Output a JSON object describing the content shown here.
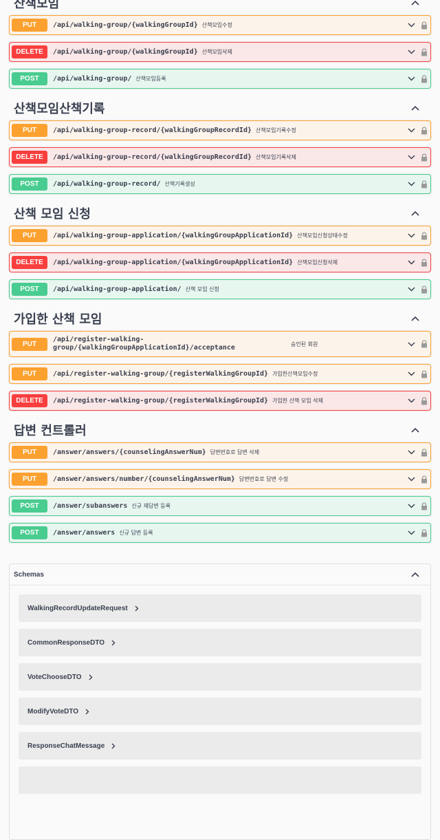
{
  "sections": [
    {
      "title": "산책모임",
      "ops": [
        {
          "method": "PUT",
          "cls": "put",
          "path": "/api/walking-group/{walkingGroupId}",
          "desc": "산책모임수정"
        },
        {
          "method": "DELETE",
          "cls": "delete",
          "path": "/api/walking-group/{walkingGroupId}",
          "desc": "산책모임삭제"
        },
        {
          "method": "POST",
          "cls": "post",
          "path": "/api/walking-group/",
          "desc": "산책모임등록"
        }
      ]
    },
    {
      "title": "산책모임산책기록",
      "ops": [
        {
          "method": "PUT",
          "cls": "put",
          "path": "/api/walking-group-record/{walkingGroupRecordId}",
          "desc": "산책모임기록수정"
        },
        {
          "method": "DELETE",
          "cls": "delete",
          "path": "/api/walking-group-record/{walkingGroupRecordId}",
          "desc": "산책모임기록삭제"
        },
        {
          "method": "POST",
          "cls": "post",
          "path": "/api/walking-group-record/",
          "desc": "산책기록생성"
        }
      ]
    },
    {
      "title": "산책 모임 신청",
      "ops": [
        {
          "method": "PUT",
          "cls": "put",
          "path": "/api/walking-group-application/{walkingGroupApplicationId}",
          "desc": "산책모임신청상태수정"
        },
        {
          "method": "DELETE",
          "cls": "delete",
          "path": "/api/walking-group-application/{walkingGroupApplicationId}",
          "desc": "산책모임신청삭제"
        },
        {
          "method": "POST",
          "cls": "post",
          "path": "/api/walking-group-application/",
          "desc": "산책 모임 신청"
        }
      ]
    },
    {
      "title": "가입한 산책 모임",
      "ops": [
        {
          "method": "PUT",
          "cls": "put",
          "path": "/api/register-walking-group/{walkingGroupApplicationId}/acceptance",
          "desc": "승인된 회원",
          "tall": true
        },
        {
          "method": "PUT",
          "cls": "put",
          "path": "/api/register-walking-group/{registerWalkingGroupId}",
          "desc": "가입한산책모임수정"
        },
        {
          "method": "DELETE",
          "cls": "delete",
          "path": "/api/register-walking-group/{registerWalkingGroupId}",
          "desc": "가입한 산책 모임 삭제"
        }
      ]
    },
    {
      "title": "답변 컨트롤러",
      "ops": [
        {
          "method": "PUT",
          "cls": "put",
          "path": "/answer/answers/{counselingAnswerNum}",
          "desc": "답변번호로 답변 삭제"
        },
        {
          "method": "PUT",
          "cls": "put",
          "path": "/answer/answers/number/{counselingAnswerNum}",
          "desc": "답변번호로 답변 수정"
        },
        {
          "method": "POST",
          "cls": "post",
          "path": "/answer/subanswers",
          "desc": "신규 재답변 등록"
        },
        {
          "method": "POST",
          "cls": "post",
          "path": "/answer/answers",
          "desc": "신규 답변 등록"
        }
      ]
    }
  ],
  "schemas": {
    "title": "Schemas",
    "models": [
      "WalkingRecordUpdateRequest",
      "CommonResponseDTO",
      "VoteChooseDTO",
      "ModifyVoteDTO",
      "ResponseChatMessage"
    ]
  },
  "colors": {
    "put": "#fca130",
    "delete": "#f93e3e",
    "post": "#49cc90"
  }
}
